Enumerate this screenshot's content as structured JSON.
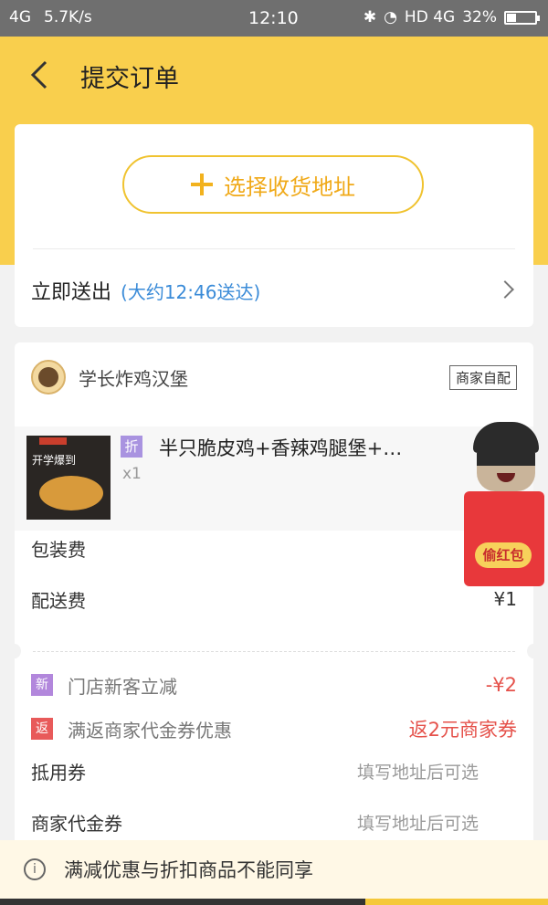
{
  "status_bar": {
    "network": "4G",
    "speed": "5.7K/s",
    "time": "12:10",
    "network_right": "HD 4G",
    "battery": "32%",
    "battery_level": 0.32
  },
  "header": {
    "title": "提交订单"
  },
  "address": {
    "select_label": "选择收货地址",
    "delivery_label": "立即送出",
    "delivery_eta": "(大约12:46送达)"
  },
  "shop": {
    "name": "学长炸鸡汉堡",
    "pickup_badge": "商家自配"
  },
  "product": {
    "image_text": "开学爆到",
    "discount_tag": "折",
    "name": "半只脆皮鸡+香辣鸡腿堡+…",
    "quantity": "x1"
  },
  "fees": {
    "packaging_label": "包装费",
    "delivery_label": "配送费",
    "delivery_value": "¥1"
  },
  "promos": {
    "new_icon": "新",
    "new_label": "门店新客立减",
    "new_value": "-¥2",
    "return_icon": "返",
    "return_label": "满返商家代金券优惠",
    "return_value": "返2元商家券"
  },
  "coupons": {
    "coupon_label": "抵用券",
    "coupon_hint": "填写地址后可选",
    "merchant_label": "商家代金券",
    "merchant_hint": "填写地址后可选"
  },
  "redpacket": {
    "label": "偷红包"
  },
  "notice": {
    "text": "满减优惠与折扣商品不能同享"
  },
  "colors": {
    "header_bg": "#f9cf4d",
    "accent": "#f0a918",
    "promo_red": "#e5514a",
    "link_blue": "#3a8bd8"
  }
}
